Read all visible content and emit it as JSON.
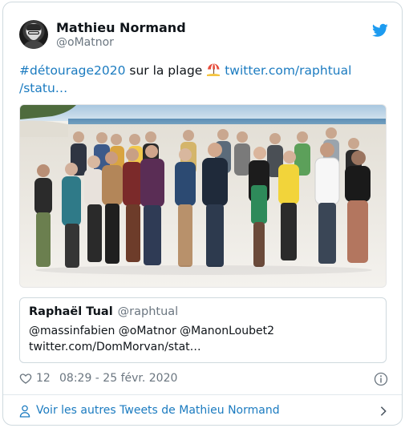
{
  "tweet": {
    "author_name": "Mathieu Normand",
    "author_handle": "@oMatnor",
    "hashtag": "#détourage2020",
    "text_mid": " sur la plage ",
    "link_line1": "twitter.com/raphtual",
    "link_line2": "/statu…",
    "photo_alt_icon": "group-photo"
  },
  "quoted": {
    "name": "Raphaël Tual",
    "handle": "@raphtual",
    "line1": "@massinfabien @oMatnor @ManonLoubet2",
    "line2": "twitter.com/DomMorvan/stat…"
  },
  "meta": {
    "likes": "12",
    "timestamp": "08:29 - 25 févr. 2020"
  },
  "footer": {
    "label": "Voir les autres Tweets de Mathieu Normand"
  },
  "colors": {
    "link": "#1b7bc0",
    "twitter_blue": "#1d9bf0",
    "border": "#cfd9de",
    "secondary_text": "#6b7680"
  },
  "icons": [
    "twitter-bird-icon",
    "beach-umbrella-icon",
    "heart-icon",
    "info-icon",
    "user-icon",
    "chevron-right-icon"
  ]
}
